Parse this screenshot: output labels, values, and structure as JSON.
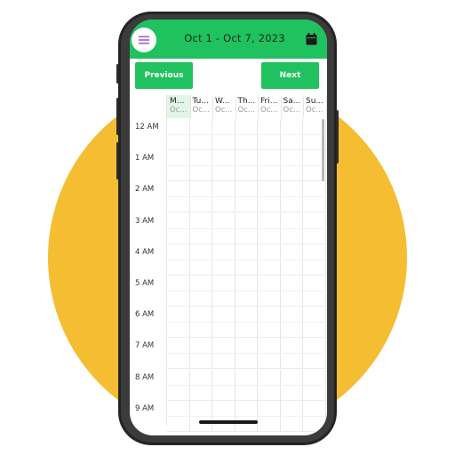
{
  "header": {
    "title": "Oct 1 - Oct 7, 2023",
    "menu_icon": "hamburger-menu-icon",
    "calendar_icon": "calendar-icon"
  },
  "nav": {
    "previous_label": "Previous",
    "next_label": "Next"
  },
  "days": [
    {
      "name": "M...",
      "date": "Oc..."
    },
    {
      "name": "Tu...",
      "date": "Oc..."
    },
    {
      "name": "W...",
      "date": "Oc..."
    },
    {
      "name": "Th...",
      "date": "Oc..."
    },
    {
      "name": "Fri...",
      "date": "Oc..."
    },
    {
      "name": "Sa...",
      "date": "Oc..."
    },
    {
      "name": "Su...",
      "date": "Oc..."
    }
  ],
  "hours": [
    "12 AM",
    "1 AM",
    "2 AM",
    "3 AM",
    "4 AM",
    "5 AM",
    "6 AM",
    "7 AM",
    "8 AM",
    "9 AM"
  ],
  "colors": {
    "accent": "#1fc25e",
    "today_highlight": "#e2f5e7",
    "background_circle": "#f4bd32",
    "menu_icon": "#a25bd6"
  }
}
